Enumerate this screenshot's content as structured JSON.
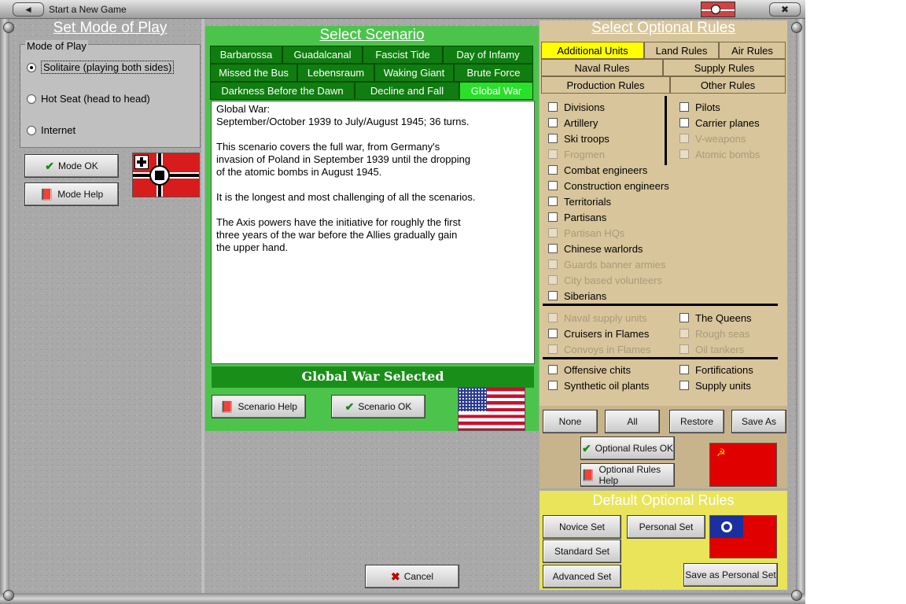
{
  "window": {
    "title": "Start a New Game"
  },
  "mode": {
    "header": "Set Mode of Play",
    "group_label": "Mode of Play",
    "options": [
      {
        "label": "Solitaire (playing both sides)",
        "selected": true
      },
      {
        "label": "Hot Seat (head to head)",
        "selected": false
      },
      {
        "label": "Internet",
        "selected": false
      }
    ],
    "ok_label": "Mode OK",
    "help_label": "Mode Help"
  },
  "scenario": {
    "header": "Select Scenario",
    "tabs_row1": [
      "Barbarossa",
      "Guadalcanal",
      "Fascist Tide",
      "Day of Infamy"
    ],
    "tabs_row2": [
      "Missed the Bus",
      "Lebensraum",
      "Waking Giant",
      "Brute Force"
    ],
    "tabs_row3": [
      "Darkness Before the Dawn",
      "Decline and Fall",
      "Global War"
    ],
    "active_tab": "Global War",
    "description": "Global War:\nSeptember/October 1939 to July/August 1945; 36 turns.\n\nThis scenario covers the full war, from Germany's\ninvasion of Poland in September 1939 until the dropping\nof the atomic bombs in August 1945.\n\nIt is the longest and most challenging of all the scenarios.\n\nThe Axis powers have the initiative for roughly the first\nthree years of the war before the Allies gradually gain\nthe upper hand.",
    "selected_label": "Global War Selected",
    "help_label": "Scenario Help",
    "ok_label": "Scenario OK"
  },
  "rules": {
    "header": "Select Optional Rules",
    "tabs_row1": [
      "Additional Units",
      "Land Rules",
      "Air Rules"
    ],
    "tabs_row2": [
      "Naval Rules",
      "Supply Rules"
    ],
    "tabs_row3": [
      "Production Rules",
      "Other Rules"
    ],
    "active_tab": "Additional Units",
    "left_col": [
      {
        "label": "Divisions",
        "enabled": true
      },
      {
        "label": "Artillery",
        "enabled": true
      },
      {
        "label": "Ski troops",
        "enabled": true
      },
      {
        "label": "Frogmen",
        "enabled": false
      },
      {
        "label": "Combat engineers",
        "enabled": true
      },
      {
        "label": "Construction engineers",
        "enabled": true
      },
      {
        "label": "Territorials",
        "enabled": true
      },
      {
        "label": "Partisans",
        "enabled": true
      },
      {
        "label": "Partisan HQs",
        "enabled": false
      },
      {
        "label": "Chinese warlords",
        "enabled": true
      },
      {
        "label": "Guards banner armies",
        "enabled": false
      },
      {
        "label": "City based volunteers",
        "enabled": false
      },
      {
        "label": "Siberians",
        "enabled": true
      }
    ],
    "right_col": [
      {
        "label": "Pilots",
        "enabled": true
      },
      {
        "label": "Carrier planes",
        "enabled": true
      },
      {
        "label": "V-weapons",
        "enabled": false
      },
      {
        "label": "Atomic bombs",
        "enabled": false
      }
    ],
    "naval_left": [
      {
        "label": "Naval supply units",
        "enabled": false
      },
      {
        "label": "Cruisers in Flames",
        "enabled": true
      },
      {
        "label": "Convoys in Flames",
        "enabled": false
      }
    ],
    "naval_right": [
      {
        "label": "The Queens",
        "enabled": true
      },
      {
        "label": "Rough seas",
        "enabled": false
      },
      {
        "label": "Oil tankers",
        "enabled": false
      }
    ],
    "prod_left": [
      {
        "label": "Offensive chits",
        "enabled": true
      },
      {
        "label": "Synthetic oil plants",
        "enabled": true
      }
    ],
    "prod_right": [
      {
        "label": "Fortifications",
        "enabled": true
      },
      {
        "label": "Supply units",
        "enabled": true
      }
    ],
    "none_label": "None",
    "all_label": "All",
    "restore_label": "Restore",
    "save_as_label": "Save As",
    "ok_label": "Optional Rules OK",
    "help_label": "Optional Rules Help"
  },
  "defaults": {
    "header": "Default Optional Rules",
    "novice_label": "Novice Set",
    "personal_label": "Personal Set",
    "standard_label": "Standard Set",
    "advanced_label": "Advanced Set",
    "save_personal_label": "Save as Personal Set"
  },
  "cancel_label": "Cancel",
  "colors": {
    "scenario_green": "#4cc44c",
    "tab_green": "#0f7d0f",
    "active_tab_green": "#28e128",
    "rules_tan": "#d8c59c",
    "active_rule_tab": "#ffff00",
    "defaults_yellow": "#e9e45a"
  },
  "icons": [
    "check-icon",
    "book-icon",
    "cancel-x-icon",
    "close-icon",
    "back-icon"
  ]
}
